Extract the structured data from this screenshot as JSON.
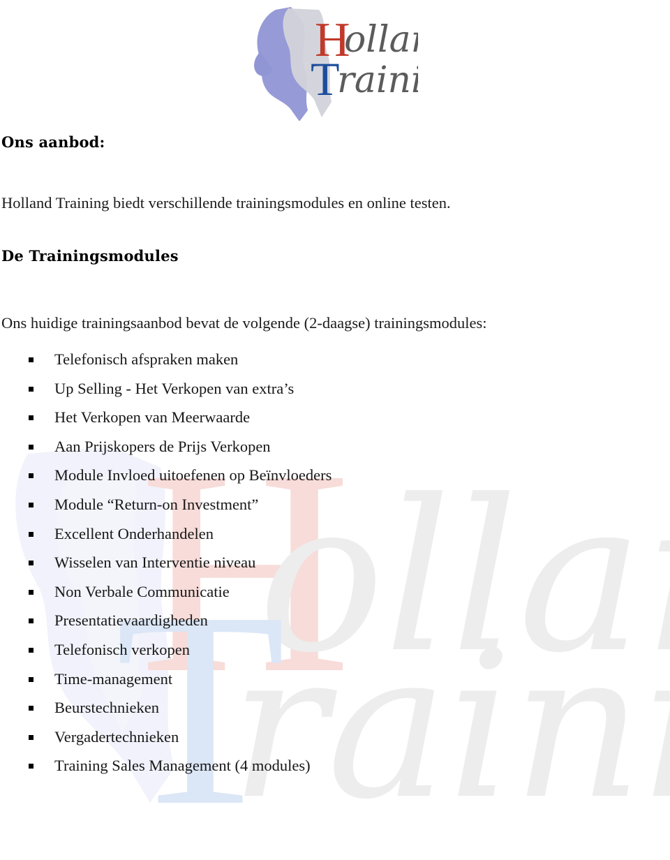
{
  "document": {
    "language": "nl",
    "background_color": "#ffffff",
    "text_color": "#000000"
  },
  "logo": {
    "name": "holland-training-logo",
    "word_one": "Holland",
    "word_two": "Training",
    "initial_one": "H",
    "initial_one_color": "#c0392b",
    "initial_two": "T",
    "initial_two_color": "#1d4e9c",
    "script_color": "#5a5a5a",
    "map_fill": "#8a8fd0",
    "map_shadow": "#d4d4d8"
  },
  "watermark": {
    "name": "holland-training-watermark",
    "word_one": "Holland",
    "word_two": "Training",
    "initial_one": "H",
    "initial_one_color": "#f6d9d6",
    "initial_two": "T",
    "initial_two_color": "#d7e3f5",
    "script_color": "#ececec",
    "map_fill": "#eceef8"
  },
  "headings": {
    "offer": "Ons aanbod:",
    "modules": "De Trainingsmodules"
  },
  "paragraphs": {
    "intro": "Holland Training biedt verschillende trainingsmodules en online testen.",
    "modules_lead": "Ons huidige trainingsaanbod bevat de volgende (2-daagse) trainingsmodules:"
  },
  "module_list": {
    "bullet_glyph": "square",
    "bullet_color": "#000000",
    "items": [
      "Telefonisch afspraken maken",
      "Up Selling - Het Verkopen van extra’s",
      "Het Verkopen van Meerwaarde",
      "Aan Prijskopers de Prijs Verkopen",
      "Module Invloed uitoefenen op Beïnvloeders",
      "Module “Return-on Investment”",
      "Excellent Onderhandelen",
      "Wisselen van Interventie niveau",
      "Non Verbale Communicatie",
      "Presentatievaardigheden",
      "Telefonisch verkopen",
      "Time-management",
      "Beurstechnieken",
      "Vergadertechnieken",
      "Training Sales Management (4 modules)"
    ]
  }
}
